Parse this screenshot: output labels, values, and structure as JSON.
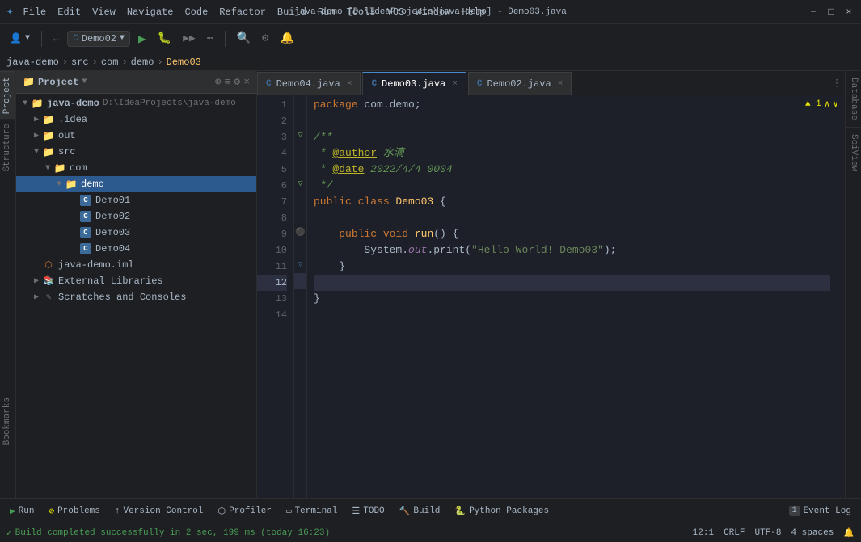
{
  "titleBar": {
    "menuItems": [
      "File",
      "Edit",
      "View",
      "Navigate",
      "Code",
      "Refactor",
      "Build",
      "Run",
      "Tools",
      "VCS",
      "Window",
      "Help"
    ],
    "title": "java-demo [D:\\IdeaProjects\\java-demo] - Demo03.java",
    "controls": [
      "−",
      "□",
      "×"
    ]
  },
  "breadcrumb": {
    "items": [
      "java-demo",
      "src",
      "com",
      "demo",
      "Demo03"
    ]
  },
  "projectPanel": {
    "title": "Project",
    "rootLabel": "java-demo",
    "rootPath": "D:\\IdeaProjects\\java-demo",
    "items": [
      {
        "label": ".idea",
        "type": "folder",
        "indent": 1,
        "expanded": false
      },
      {
        "label": "out",
        "type": "folder",
        "indent": 1,
        "expanded": false
      },
      {
        "label": "src",
        "type": "folder",
        "indent": 1,
        "expanded": true
      },
      {
        "label": "com",
        "type": "folder",
        "indent": 2,
        "expanded": true
      },
      {
        "label": "demo",
        "type": "folder",
        "indent": 3,
        "expanded": true,
        "selected": true
      },
      {
        "label": "Demo01",
        "type": "class",
        "indent": 4
      },
      {
        "label": "Demo02",
        "type": "class",
        "indent": 4
      },
      {
        "label": "Demo03",
        "type": "class",
        "indent": 4
      },
      {
        "label": "Demo04",
        "type": "class",
        "indent": 4
      },
      {
        "label": "java-demo.iml",
        "type": "iml",
        "indent": 1
      },
      {
        "label": "External Libraries",
        "type": "extlib",
        "indent": 1
      },
      {
        "label": "Scratches and Consoles",
        "type": "extlib",
        "indent": 1
      }
    ]
  },
  "tabs": [
    {
      "label": "Demo04.java",
      "active": false,
      "modified": false
    },
    {
      "label": "Demo03.java",
      "active": true,
      "modified": false
    },
    {
      "label": "Demo02.java",
      "active": false,
      "modified": false
    }
  ],
  "editor": {
    "warningCount": "▲ 1",
    "lines": [
      {
        "num": 1,
        "code": "package com.demo;",
        "type": "normal"
      },
      {
        "num": 2,
        "code": "",
        "type": "normal"
      },
      {
        "num": 3,
        "code": "/**",
        "type": "comment",
        "hasGutter": true
      },
      {
        "num": 4,
        "code": " * @author 水滴",
        "type": "comment"
      },
      {
        "num": 5,
        "code": " * @date 2022/4/4 0004",
        "type": "comment"
      },
      {
        "num": 6,
        "code": " */",
        "type": "comment",
        "hasGutter": true
      },
      {
        "num": 7,
        "code": "public class Demo03 {",
        "type": "normal"
      },
      {
        "num": 8,
        "code": "",
        "type": "normal"
      },
      {
        "num": 9,
        "code": "    public void run() {",
        "type": "normal",
        "hasGutter": true
      },
      {
        "num": 10,
        "code": "        System.out.print(\"Hello World! Demo03\");",
        "type": "normal"
      },
      {
        "num": 11,
        "code": "    }",
        "type": "normal",
        "hasGutter": true
      },
      {
        "num": 12,
        "code": "",
        "type": "current"
      },
      {
        "num": 13,
        "code": "}",
        "type": "normal"
      },
      {
        "num": 14,
        "code": "",
        "type": "normal"
      }
    ]
  },
  "statusBar": {
    "message": "Build completed successfully in 2 sec, 199 ms (today 16:23)",
    "cursor": "12:1",
    "lineEnding": "CRLF",
    "encoding": "UTF-8",
    "indent": "4 spaces"
  },
  "bottomTabs": [
    {
      "label": "Run",
      "icon": "▶"
    },
    {
      "label": "Problems",
      "icon": "⊘"
    },
    {
      "label": "Version Control",
      "icon": "↑"
    },
    {
      "label": "Profiler",
      "icon": "⬡"
    },
    {
      "label": "Terminal",
      "icon": ">_"
    },
    {
      "label": "TODO",
      "icon": "☰"
    },
    {
      "label": "Build",
      "icon": "🔨"
    },
    {
      "label": "Python Packages",
      "icon": "🐍"
    }
  ],
  "eventLog": {
    "label": "Event Log",
    "badge": "1"
  },
  "rightSidebarLabels": [
    "Database",
    "SciView"
  ],
  "leftSidebarLabel": "Structure",
  "bookmarksLabel": "Bookmarks"
}
